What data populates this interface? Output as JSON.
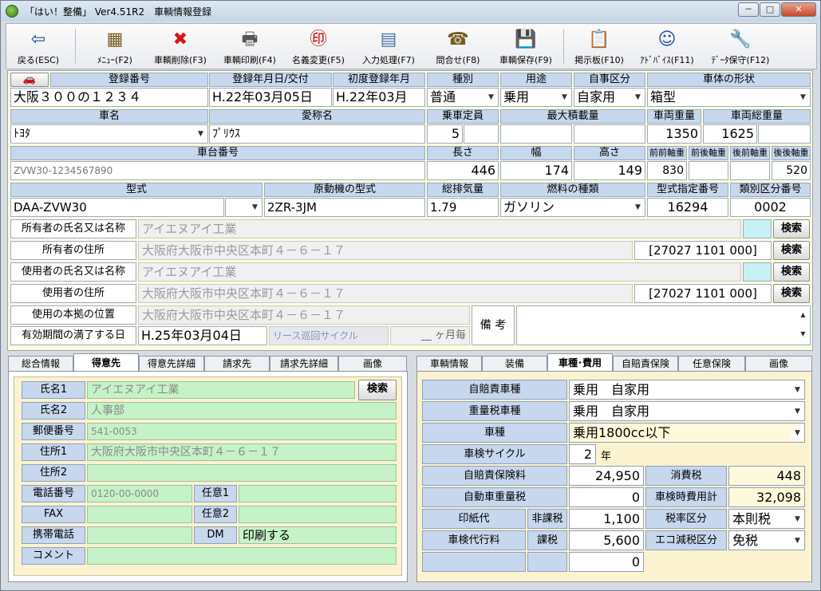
{
  "window": {
    "title": "「はい！整備」 Ver4.51R2　車輌情報登録",
    "btn_min": "─",
    "btn_max": "□",
    "btn_close": "✕"
  },
  "toolbar": [
    {
      "name": "back",
      "label": "戻る(ESC)",
      "icon": "⇦"
    },
    {
      "name": "menu",
      "label": "ﾒﾆｭｰ(F2)",
      "icon": "▦"
    },
    {
      "name": "delete",
      "label": "車輌削除(F3)",
      "icon": "✖"
    },
    {
      "name": "print",
      "label": "車輌印刷(F4)",
      "icon": "🖶"
    },
    {
      "name": "rename",
      "label": "名義変更(F5)",
      "icon": "㊞"
    },
    {
      "name": "input",
      "label": "入力処理(F7)",
      "icon": "▤"
    },
    {
      "name": "inquiry",
      "label": "問合せ(F8)",
      "icon": "☎"
    },
    {
      "name": "save",
      "label": "車輌保存(F9)",
      "icon": "💾"
    },
    {
      "name": "board",
      "label": "掲示板(F10)",
      "icon": "📋"
    },
    {
      "name": "advice",
      "label": "ｱﾄﾞﾊﾞｲｽ(F11)",
      "icon": "☺"
    },
    {
      "name": "datasave",
      "label": "ﾃﾞｰﾀ保守(F12)",
      "icon": "🔧"
    }
  ],
  "h": {
    "reg_no": "登録番号",
    "reg_date": "登録年月日/交付",
    "first_reg": "初度登録年月",
    "kind": "種別",
    "use": "用途",
    "private": "自事区分",
    "body_shape": "車体の形状",
    "car_name": "車名",
    "nickname": "愛称名",
    "capacity": "乗車定員",
    "max_load": "最大積載量",
    "weight": "車両重量",
    "gross": "車両総重量",
    "chassis": "車台番号",
    "length": "長さ",
    "width": "幅",
    "height": "高さ",
    "ff": "前前軸重",
    "fr": "前後軸重",
    "rf": "後前軸重",
    "rr": "後後軸重",
    "model": "型式",
    "engine": "原動機の型式",
    "disp": "総排気量",
    "fuel": "燃料の種類",
    "model_no": "型式指定番号",
    "class_no": "類別区分番号",
    "owner": "所有者の氏名又は名称",
    "owner_addr": "所有者の住所",
    "user": "使用者の氏名又は名称",
    "user_addr": "使用者の住所",
    "base": "使用の本拠の位置",
    "expiry": "有効期間の満了する日",
    "memo": "備 考"
  },
  "v": {
    "reg_no": "大阪３００の１２３４",
    "reg_date": "H.22年03月05日",
    "first_reg": "H.22年03月",
    "kind": "普通",
    "use": "乗用",
    "private": "自家用",
    "body_shape": "箱型",
    "car_name": "ﾄﾖﾀ",
    "nickname": "ﾌﾟﾘｳｽ",
    "capacity": "5",
    "weight": "1350",
    "gross": "1625",
    "chassis": "ZVW30-1234567890",
    "length": "446",
    "width": "174",
    "height": "149",
    "ff": "830",
    "rr": "520",
    "model": "DAA-ZVW30",
    "engine": "2ZR-3JM",
    "disp": "1.79",
    "fuel": "ガソリン",
    "model_no": "16294",
    "class_no": "0002",
    "owner": "アイエヌアイ工業",
    "owner_addr": "大阪府大阪市中央区本町４－６－１７",
    "owner_code": "[27027 1101 000]",
    "user": "アイエヌアイ工業",
    "user_addr": "大阪府大阪市中央区本町４－６－１７",
    "user_code": "[27027 1101 000]",
    "base": "大阪府大阪市中央区本町４－６－１７",
    "expiry": "H.25年03月04日",
    "lease": "リース巡回サイクル",
    "lease_unit": "__ ヶ月毎"
  },
  "search": "検索",
  "left_tabs": [
    "総合情報",
    "得意先",
    "得意先詳細",
    "請求先",
    "請求先詳細",
    "画像"
  ],
  "customer": {
    "name1_l": "氏名1",
    "name1": "アイエヌアイ工業",
    "name2_l": "氏名2",
    "name2": "人事部",
    "zip_l": "郵便番号",
    "zip": "541-0053",
    "addr1_l": "住所1",
    "addr1": "大阪府大阪市中央区本町４－６－１７",
    "addr2_l": "住所2",
    "tel_l": "電話番号",
    "tel": "0120-00-0000",
    "opt1_l": "任意1",
    "fax_l": "FAX",
    "opt2_l": "任意2",
    "mobile_l": "携帯電話",
    "dm_l": "DM",
    "dm": "印刷する",
    "comment_l": "コメント"
  },
  "right_tabs": [
    "車輌情報",
    "装備",
    "車種･費用",
    "自賠責保険",
    "任意保険",
    "画像"
  ],
  "cost": {
    "jibai_l": "自賠責車種",
    "jibai": "乗用　自家用",
    "juryo_l": "重量税車種",
    "juryo": "乗用　自家用",
    "shashu_l": "車種",
    "shashu": "乗用1800cc以下",
    "cycle_l": "車検サイクル",
    "cycle": "2",
    "cycle_u": "年",
    "ins_l": "自賠責保険料",
    "ins": "24,950",
    "tax_l": "消費税",
    "tax": "448",
    "wt_l": "自動車重量税",
    "wt": "0",
    "total_l": "車検時費用計",
    "total": "32,098",
    "stamp_l": "印紙代",
    "nontax_l": "非課税",
    "stamp": "1,100",
    "rate_l": "税率区分",
    "rate": "本則税",
    "agent_l": "車検代行料",
    "taxed_l": "課税",
    "agent": "5,600",
    "eco_l": "エコ減税区分",
    "eco": "免税",
    "extra": "0"
  }
}
